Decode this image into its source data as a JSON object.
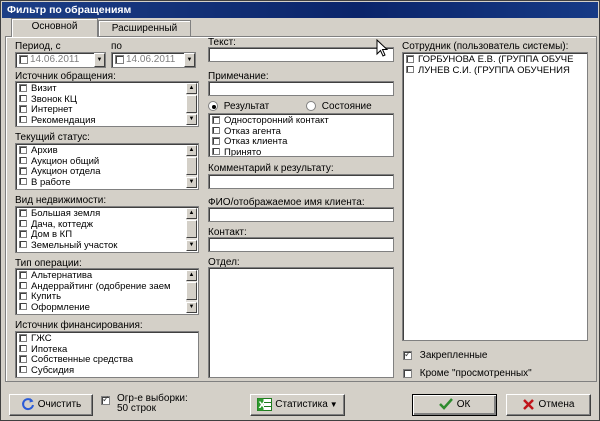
{
  "window": {
    "title": "Фильтр по обращениям"
  },
  "tabs": [
    {
      "label": "Основной",
      "active": true
    },
    {
      "label": "Расширенный",
      "active": false
    }
  ],
  "period": {
    "from_label": "Период, с",
    "to_label": "по",
    "from_value": "14.06.2011",
    "to_value": "14.06.2011"
  },
  "lists": {
    "source": {
      "label": "Источник обращения:",
      "items": [
        "Визит",
        "Звонок КЦ",
        "Интернет",
        "Рекомендация"
      ]
    },
    "status": {
      "label": "Текущий статус:",
      "items": [
        "Архив",
        "Аукцион общий",
        "Аукцион отдела",
        "В работе"
      ]
    },
    "property": {
      "label": "Вид недвижимости:",
      "items": [
        "Большая земля",
        "Дача, коттедж",
        "Дом в КП",
        "Земельный участок"
      ]
    },
    "operation": {
      "label": "Тип операции:",
      "items": [
        "Альтернатива",
        "Андеррайтинг (одобрение заем",
        "Купить",
        "Оформление"
      ]
    },
    "financing": {
      "label": "Источник финансирования:",
      "items": [
        "ГЖС",
        "Ипотека",
        "Собственные средства",
        "Субсидия"
      ]
    }
  },
  "text_fields": {
    "text_label": "Текст:",
    "note_label": "Примечание:",
    "comment_label": "Комментарий к результату:",
    "fio_label": "ФИО/отображаемое имя клиента:",
    "contact_label": "Контакт:",
    "department_label": "Отдел:"
  },
  "result_block": {
    "radio_result": "Результат",
    "radio_state": "Состояние",
    "selected": "result",
    "items": [
      "Односторонний контакт",
      "Отказ агента",
      "Отказ клиента",
      "Принято"
    ]
  },
  "employees": {
    "label": "Сотрудник (пользователь системы):",
    "items": [
      "ГОРБУНОВА Е.В. (ГРУППА ОБУЧЕ",
      "ЛУНЕВ С.И. (ГРУППА ОБУЧЕНИЯ"
    ]
  },
  "options": {
    "pinned_label": "Закрепленные",
    "pinned_checked": true,
    "except_viewed_label": "Кроме \"просмотренных\"",
    "except_viewed_checked": false
  },
  "footer": {
    "clear_label": "Очистить",
    "limit_line1": "Огр-е выборки:",
    "limit_line2": "50 строк",
    "limit_checked": true,
    "stats_label": "Статистика",
    "ok_label": "ОК",
    "cancel_label": "Отмена"
  },
  "colors": {
    "titlebar": "#0a246a",
    "face": "#d4d0c8",
    "ok_check": "#2e8b2e",
    "cancel_x": "#c0141a"
  }
}
